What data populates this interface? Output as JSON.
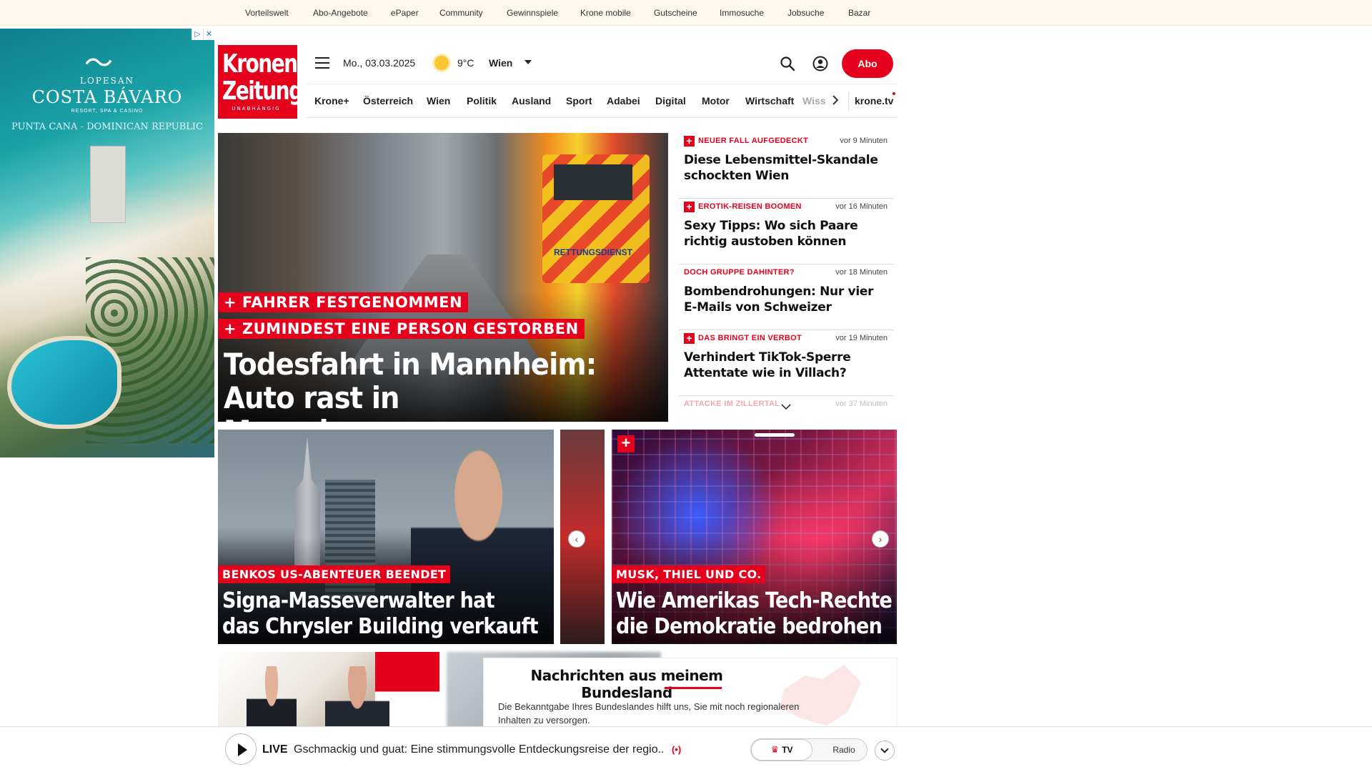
{
  "service_nav": [
    "Vorteilswelt",
    "Abo-Angebote",
    "ePaper",
    "Community",
    "Gewinnspiele",
    "Krone mobile",
    "Gutscheine",
    "Immosuche",
    "Jobsuche",
    "Bazar"
  ],
  "ad": {
    "brand_small": "LOPESAN",
    "brand": "COSTA BÁVARO",
    "brand_tag": "RESORT, SPA & CASINO",
    "location": "PUNTA CANA - DOMINICAN REPUBLIC",
    "adchoices_icon": "adchoices-icon",
    "close_icon": "close-icon"
  },
  "header": {
    "logo_line1": "Kronen",
    "logo_line2": "Zeitung",
    "logo_line3": "UNABHÄNGIG",
    "date": "Mo., 03.03.2025",
    "temperature": "9°C",
    "city": "Wien",
    "abo_label": "Abo",
    "weather_icon": "sun-icon",
    "brand_color": "#e5001b"
  },
  "main_nav": {
    "items": [
      "Krone+",
      "Österreich",
      "Wien",
      "Politik",
      "Ausland",
      "Sport",
      "Adabei",
      "Digital",
      "Motor",
      "Wirtschaft"
    ],
    "truncated": "Wiss",
    "tv_link": "krone.tv"
  },
  "lead": {
    "tag1": "+ FAHRER FESTGENOMMEN",
    "tag2": "+ ZUMINDEST EINE PERSON GESTORBEN",
    "headline_line1": "Todesfahrt in Mannheim:",
    "headline_line2": "Auto rast in Menschenmenge",
    "image_text": "RETTUNGSDIENST"
  },
  "ticker": [
    {
      "plus": true,
      "kicker": "NEUER FALL AUFGEDECKT",
      "time": "vor 9 Minuten",
      "title": "Diese Lebensmittel-Skandale schockten Wien"
    },
    {
      "plus": true,
      "kicker": "EROTIK-REISEN BOOMEN",
      "time": "vor 16 Minuten",
      "title": "Sexy Tipps: Wo sich Paare richtig austoben können"
    },
    {
      "plus": false,
      "kicker": "DOCH GRUPPE DAHINTER?",
      "time": "vor 18 Minuten",
      "title": "Bombendrohungen: Nur vier E-Mails von Schweizer"
    },
    {
      "plus": true,
      "kicker": "DAS BRINGT EIN VERBOT",
      "time": "vor 19 Minuten",
      "title": "Verhindert TikTok-Sperre Attentate wie in Villach?"
    },
    {
      "plus": false,
      "kicker": "ATTACKE IM ZILLERTAL",
      "time": "vor 37 Minuten",
      "title": ""
    }
  ],
  "carousel": [
    {
      "tag": "BENKOS US-ABENTEUER BEENDET",
      "line1": "Signa-Masseverwalter hat",
      "line2": "das Chrysler Building verkauft"
    },
    {
      "tag": "MUSK, THIEL UND CO.",
      "line1": "Wie Amerikas Tech-Rechte",
      "line2": "die Demokratie bedrohen"
    }
  ],
  "region_box": {
    "title": "Nachrichten aus meinem Bundesland",
    "text_line1": "Die Bekanntgabe Ihres Bundeslandes hilft uns, Sie mit noch regionaleren",
    "text_line2": "Inhalten zu versorgen."
  },
  "player": {
    "live_label": "LIVE",
    "title": "Gschmackig und guat: Eine stimmungsvolle Entdeckungsreise der regio...",
    "cast_icon": "(•)",
    "tv_label": "TV",
    "radio_label": "Radio"
  }
}
